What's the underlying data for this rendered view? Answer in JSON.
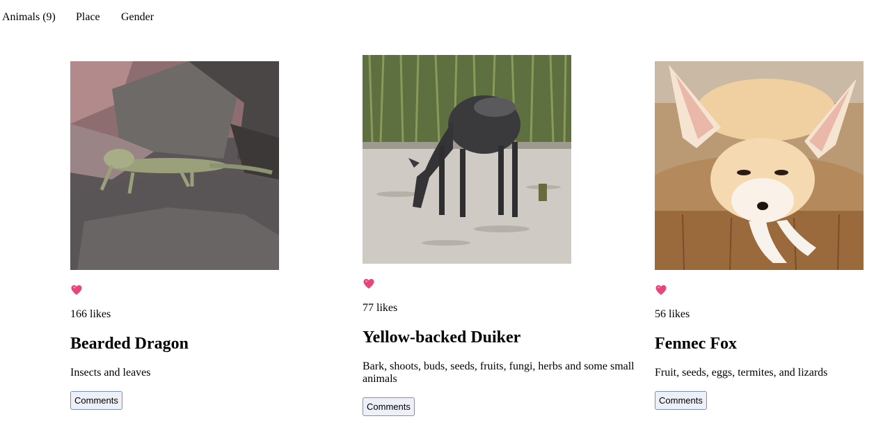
{
  "nav": {
    "items": [
      "Animals (9)",
      "Place",
      "Gender"
    ]
  },
  "cards": [
    {
      "name": "Bearded Dragon",
      "likes": "166 likes",
      "diet": "Insects and leaves",
      "comments_label": "Comments",
      "image": "bearded-dragon-on-rock"
    },
    {
      "name": "Yellow-backed Duiker",
      "likes": "77 likes",
      "diet": "Bark, shoots, buds, seeds, fruits, fungi, herbs and some small animals",
      "comments_label": "Comments",
      "image": "duiker-grazing"
    },
    {
      "name": "Fennec Fox",
      "likes": "56 likes",
      "diet": "Fruit, seeds, eggs, termites, and lizards",
      "comments_label": "Comments",
      "image": "fennec-fox-resting"
    }
  ],
  "icons": {
    "like": "heart-icon"
  },
  "colors": {
    "heart": "#e8457c",
    "button_bg": "#eef0f8",
    "button_border": "#7a8fbf"
  }
}
